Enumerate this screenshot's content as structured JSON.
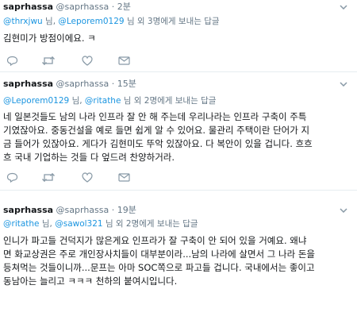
{
  "tweets": [
    {
      "username": "saprhassa",
      "handle": "@saprhassa",
      "separator": "·",
      "time": "2분",
      "reply_to": [
        "@thrxjwu",
        "@Leporem0129"
      ],
      "reply_joiner": "님,",
      "reply_suffix": "님 외 3명에게 보내는 답글",
      "lines": [
        "김현미가 방점이에요. ㅋ"
      ]
    },
    {
      "username": "saprhassa",
      "handle": "@saprhassa",
      "separator": "·",
      "time": "15분",
      "reply_to": [
        "@Leporem0129",
        "@ritathe"
      ],
      "reply_joiner": "님,",
      "reply_suffix": "님 외 2명에게 보내는 답글",
      "lines": [
        "네 일본것들도 남의 나라 인프라 잘 안 해 주는데 우리나라는 인프라 구축이 주특",
        "기였잖아요. 중동건설을 예로 들면 쉽게 알 수 있어요. 물관리 주택이란 단어가 지",
        "금 들어가 있잖아요. 게다가 김현미도 뚜악 있잖아요. 다 복안이 있을 겁니다. 흐흐",
        "흐 국내 기업하는 것들 다 엎드려 찬양하거라."
      ]
    },
    {
      "username": "saprhassa",
      "handle": "@saprhassa",
      "separator": "·",
      "time": "19분",
      "reply_to": [
        "@ritathe",
        "@sawol321"
      ],
      "reply_joiner": "님,",
      "reply_suffix": "님 외 2명에게 보내는 답글",
      "lines": [
        "인니가 파고들 건덕지가 많은게요 인프라가 잘 구축이 안 되어 있을 거예요. 왜냐",
        "면 화교상권은 주로 개인장사치들이 대부분이라...남의 나라에 살면서 그 나라 돈을",
        "등쳐먹는 것들이니까...문프는 아마 SOC쪽으로 파고들 겁니다. 국내에서는 좋이고",
        "동남아는 늘리고 ㅋㅋㅋ 천하의 붙여시입니다."
      ]
    }
  ],
  "icons": {
    "caret": "chevron-down-icon",
    "reply": "reply-icon",
    "retweet": "retweet-icon",
    "like": "heart-icon",
    "dm": "envelope-icon"
  },
  "colors": {
    "text": "#14171a",
    "secondary": "#657786",
    "link": "#1b95e0",
    "divider": "#e6ecf0",
    "icon": "#8899a6"
  }
}
